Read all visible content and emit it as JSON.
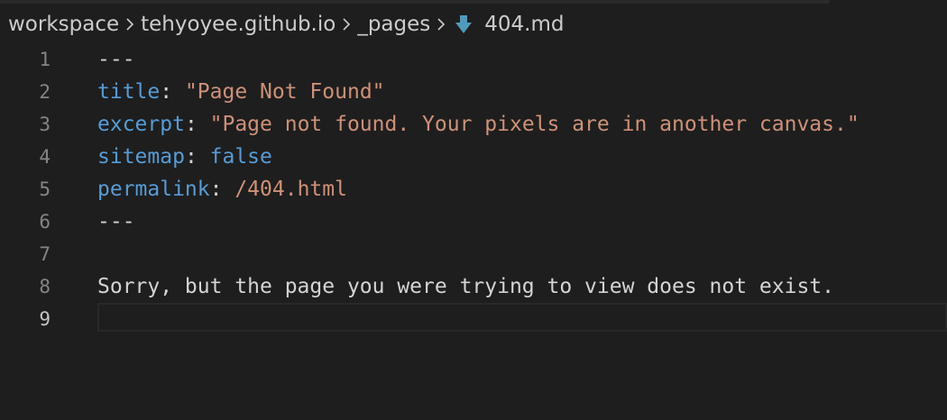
{
  "breadcrumb": {
    "items": [
      "workspace",
      "tehyoyee.github.io",
      "_pages",
      "404.md"
    ]
  },
  "editor": {
    "lines": [
      {
        "num": "1",
        "parts": [
          {
            "t": "---",
            "c": "plain"
          }
        ]
      },
      {
        "num": "2",
        "parts": [
          {
            "t": "title",
            "c": "key"
          },
          {
            "t": ": ",
            "c": "plain"
          },
          {
            "t": "\"Page Not Found\"",
            "c": "str"
          }
        ]
      },
      {
        "num": "3",
        "parts": [
          {
            "t": "excerpt",
            "c": "key"
          },
          {
            "t": ": ",
            "c": "plain"
          },
          {
            "t": "\"Page not found. Your pixels are in another canvas.\"",
            "c": "str"
          }
        ]
      },
      {
        "num": "4",
        "parts": [
          {
            "t": "sitemap",
            "c": "key"
          },
          {
            "t": ": ",
            "c": "plain"
          },
          {
            "t": "false",
            "c": "bool"
          }
        ]
      },
      {
        "num": "5",
        "parts": [
          {
            "t": "permalink",
            "c": "key"
          },
          {
            "t": ": ",
            "c": "plain"
          },
          {
            "t": "/404.html",
            "c": "str"
          }
        ]
      },
      {
        "num": "6",
        "parts": [
          {
            "t": "---",
            "c": "plain"
          }
        ]
      },
      {
        "num": "7",
        "parts": []
      },
      {
        "num": "8",
        "parts": [
          {
            "t": "Sorry, but the page you were trying to view does not exist.",
            "c": "plain"
          }
        ]
      },
      {
        "num": "9",
        "parts": [],
        "active": true
      }
    ]
  },
  "colors": {
    "background": "#1e1e1e",
    "key": "#569cd6",
    "string": "#ce9178",
    "text": "#d4d4d4",
    "line_number": "#858585",
    "file_icon": "#519aba"
  }
}
